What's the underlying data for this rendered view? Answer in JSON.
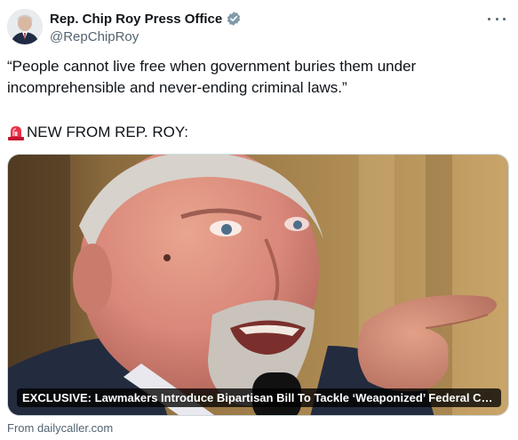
{
  "author": {
    "display_name": "Rep. Chip Roy Press Office",
    "handle": "@RepChipRoy",
    "verified_badge_color": "#829aab"
  },
  "tweet": {
    "text_line_1": "“People cannot live free when government buries them under",
    "text_line_2": "incomprehensible and never-ending criminal laws.”",
    "alert_text": "NEW FROM REP. ROY:"
  },
  "link_card": {
    "title": "EXCLUSIVE: Lawmakers Introduce Bipartisan Bill To Tackle ‘Weaponized’ Federal Crimin...",
    "source_text": "From dailycaller.com"
  },
  "icons": {
    "more": "more-icon",
    "verified": "verified-badge-icon",
    "alert": "rotating-light-icon"
  }
}
